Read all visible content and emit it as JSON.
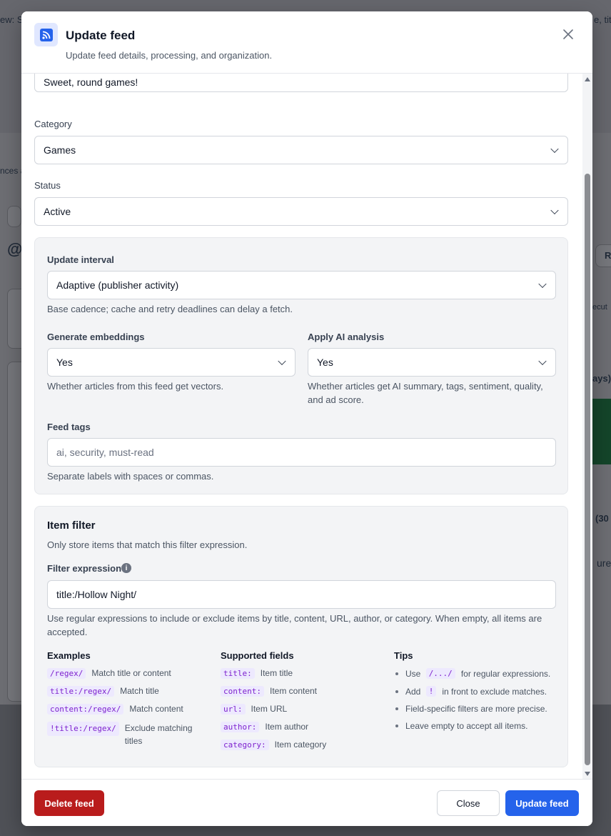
{
  "background": {
    "fragments": [
      "ew: S",
      "e, tit",
      "nces a",
      "@",
      "R",
      "ecut",
      "ays)",
      "(30",
      "ures"
    ]
  },
  "modal": {
    "title": "Update feed",
    "subtitle": "Update feed details, processing, and organization.",
    "icon": "rss-icon"
  },
  "form": {
    "description_value": "Sweet, round games!",
    "category": {
      "label": "Category",
      "value": "Games"
    },
    "status": {
      "label": "Status",
      "value": "Active"
    },
    "update_interval": {
      "label": "Update interval",
      "value": "Adaptive (publisher activity)",
      "help": "Base cadence; cache and retry deadlines can delay a fetch."
    },
    "embeddings": {
      "label": "Generate embeddings",
      "value": "Yes",
      "help": "Whether articles from this feed get vectors."
    },
    "ai_analysis": {
      "label": "Apply AI analysis",
      "value": "Yes",
      "help": "Whether articles get AI summary, tags, sentiment, quality, and ad score."
    },
    "tags": {
      "label": "Feed tags",
      "placeholder": "ai, security, must-read",
      "help": "Separate labels with spaces or commas."
    }
  },
  "filter": {
    "title": "Item filter",
    "subtitle": "Only store items that match this filter expression.",
    "label": "Filter expression",
    "value": "title:/Hollow Night/",
    "help": "Use regular expressions to include or exclude items by title, content, URL, author, or category. When empty, all items are accepted.",
    "examples_title": "Examples",
    "examples": [
      {
        "code": "/regex/",
        "desc": "Match title or content"
      },
      {
        "code": "title:/regex/",
        "desc": "Match title"
      },
      {
        "code": "content:/regex/",
        "desc": "Match content"
      },
      {
        "code": "!title:/regex/",
        "desc": "Exclude matching titles"
      }
    ],
    "fields_title": "Supported fields",
    "fields": [
      {
        "code": "title:",
        "desc": "Item title"
      },
      {
        "code": "content:",
        "desc": "Item content"
      },
      {
        "code": "url:",
        "desc": "Item URL"
      },
      {
        "code": "author:",
        "desc": "Item author"
      },
      {
        "code": "category:",
        "desc": "Item category"
      }
    ],
    "tips_title": "Tips",
    "tips": [
      {
        "pre": "Use",
        "code": "/.../",
        "post": "for regular expressions."
      },
      {
        "pre": "Add",
        "code": "!",
        "post": "in front to exclude matches."
      },
      {
        "pre": "Field-specific filters are more precise.",
        "code": "",
        "post": ""
      },
      {
        "pre": "Leave empty to accept all items.",
        "code": "",
        "post": ""
      }
    ]
  },
  "footer": {
    "delete_label": "Delete feed",
    "close_label": "Close",
    "update_label": "Update feed"
  },
  "colors": {
    "primary": "#2563eb",
    "danger": "#b91c1c",
    "code_text": "#7e22ce"
  }
}
